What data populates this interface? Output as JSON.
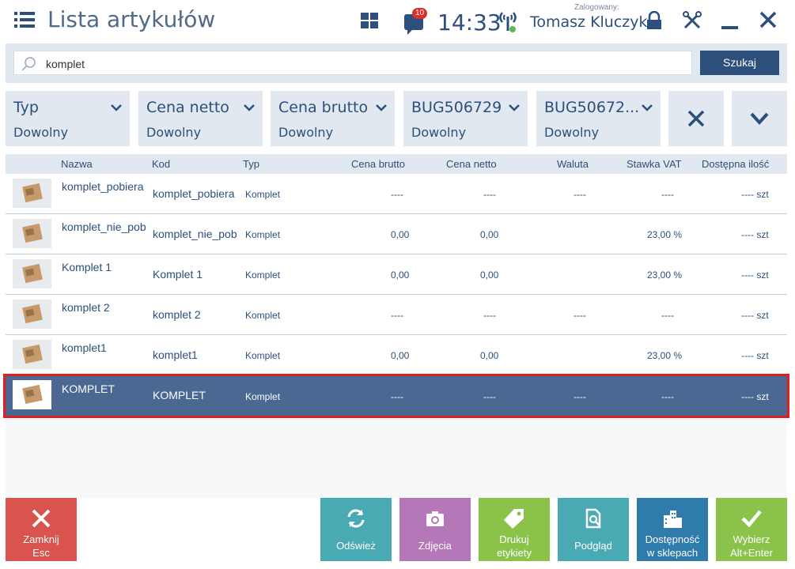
{
  "header": {
    "title": "Lista artykułów",
    "badge_count": "10",
    "time": "14:33",
    "logged_label": "Zalogowany:",
    "user_name": "Tomasz Kluczyk"
  },
  "search": {
    "value": "komplet",
    "button_label": "Szukaj"
  },
  "filters": [
    {
      "label": "Typ",
      "value": "Dowolny"
    },
    {
      "label": "Cena netto",
      "value": "Dowolny"
    },
    {
      "label": "Cena brutto",
      "value": "Dowolny"
    },
    {
      "label": "BUG506729",
      "value": "Dowolny"
    },
    {
      "label": "BUG50672...",
      "value": "Dowolny"
    }
  ],
  "table": {
    "columns": [
      "Nazwa",
      "Kod",
      "Typ",
      "Cena brutto",
      "Cena netto",
      "Waluta",
      "Stawka VAT",
      "Dostępna ilość"
    ],
    "rows": [
      {
        "name": "komplet_pobiera",
        "code": "komplet_pobiera",
        "type": "Komplet",
        "gross": "----",
        "net": "----",
        "currency": "----",
        "vat": "----",
        "qty": "---- szt"
      },
      {
        "name": "komplet_nie_pob",
        "code": "komplet_nie_pob",
        "type": "Komplet",
        "gross": "0,00",
        "net": "0,00",
        "currency": "",
        "vat": "23,00 %",
        "qty": "---- szt"
      },
      {
        "name": "Komplet 1",
        "code": "Komplet 1",
        "type": "Komplet",
        "gross": "0,00",
        "net": "0,00",
        "currency": "",
        "vat": "23,00 %",
        "qty": "---- szt"
      },
      {
        "name": "komplet 2",
        "code": "komplet 2",
        "type": "Komplet",
        "gross": "----",
        "net": "----",
        "currency": "----",
        "vat": "----",
        "qty": "---- szt"
      },
      {
        "name": "komplet1",
        "code": "komplet1",
        "type": "Komplet",
        "gross": "0,00",
        "net": "0,00",
        "currency": "",
        "vat": "23,00 %",
        "qty": "---- szt"
      },
      {
        "name": "KOMPLET",
        "code": "KOMPLET",
        "type": "Komplet",
        "gross": "----",
        "net": "----",
        "currency": "----",
        "vat": "----",
        "qty": "---- szt"
      }
    ]
  },
  "footer": {
    "close": {
      "line1": "Zamknij",
      "line2": "Esc",
      "color": "#d9534f"
    },
    "refresh": {
      "label": "Odśwież",
      "color": "#4aaab4"
    },
    "photos": {
      "label": "Zdjęcia",
      "color": "#b478b8"
    },
    "print": {
      "line1": "Drukuj",
      "line2": "etykiety",
      "color": "#8bc34a"
    },
    "preview": {
      "label": "Podgląd",
      "color": "#4aaab4"
    },
    "availability": {
      "line1": "Dostępność",
      "line2": "w sklepach",
      "color": "#2f7bab"
    },
    "select": {
      "line1": "Wybierz",
      "line2": "Alt+Enter",
      "color": "#8bc34a"
    }
  }
}
